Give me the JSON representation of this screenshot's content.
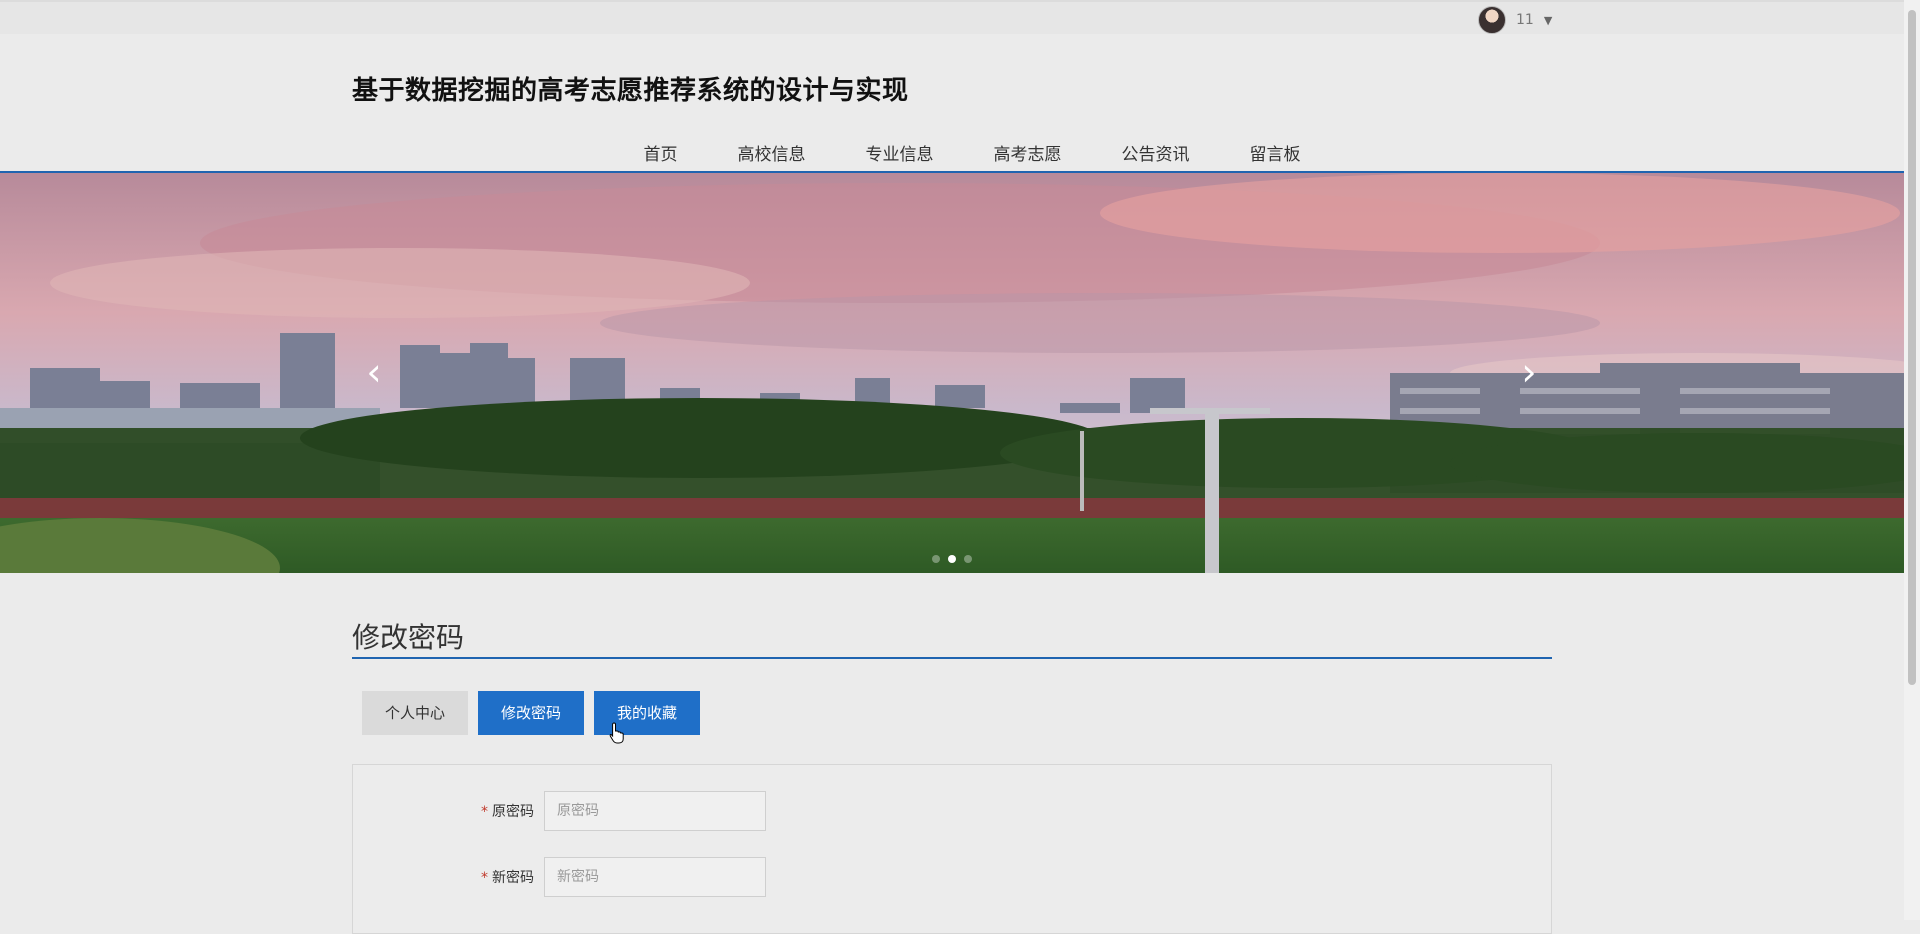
{
  "topbar": {
    "username": "11",
    "avatar_icon": "user-avatar",
    "caret_icon": "caret-down-icon"
  },
  "header": {
    "site_title": "基于数据挖掘的高考志愿推荐系统的设计与实现",
    "nav": [
      "首页",
      "高校信息",
      "专业信息",
      "高考志愿",
      "公告资讯",
      "留言板"
    ]
  },
  "banner": {
    "prev_icon": "‹",
    "next_icon": "›",
    "slide_count": 3,
    "active_slide": 2
  },
  "page": {
    "section_title": "修改密码",
    "tabs": [
      "个人中心",
      "修改密码",
      "我的收藏"
    ]
  },
  "form": {
    "fields": [
      {
        "label": "原密码",
        "placeholder": "原密码",
        "required": true,
        "value": ""
      },
      {
        "label": "新密码",
        "placeholder": "新密码",
        "required": true,
        "value": ""
      }
    ]
  },
  "colors": {
    "accent": "#1f64b0",
    "tab_blue": "#1f6fc8",
    "required": "#c0392b"
  }
}
